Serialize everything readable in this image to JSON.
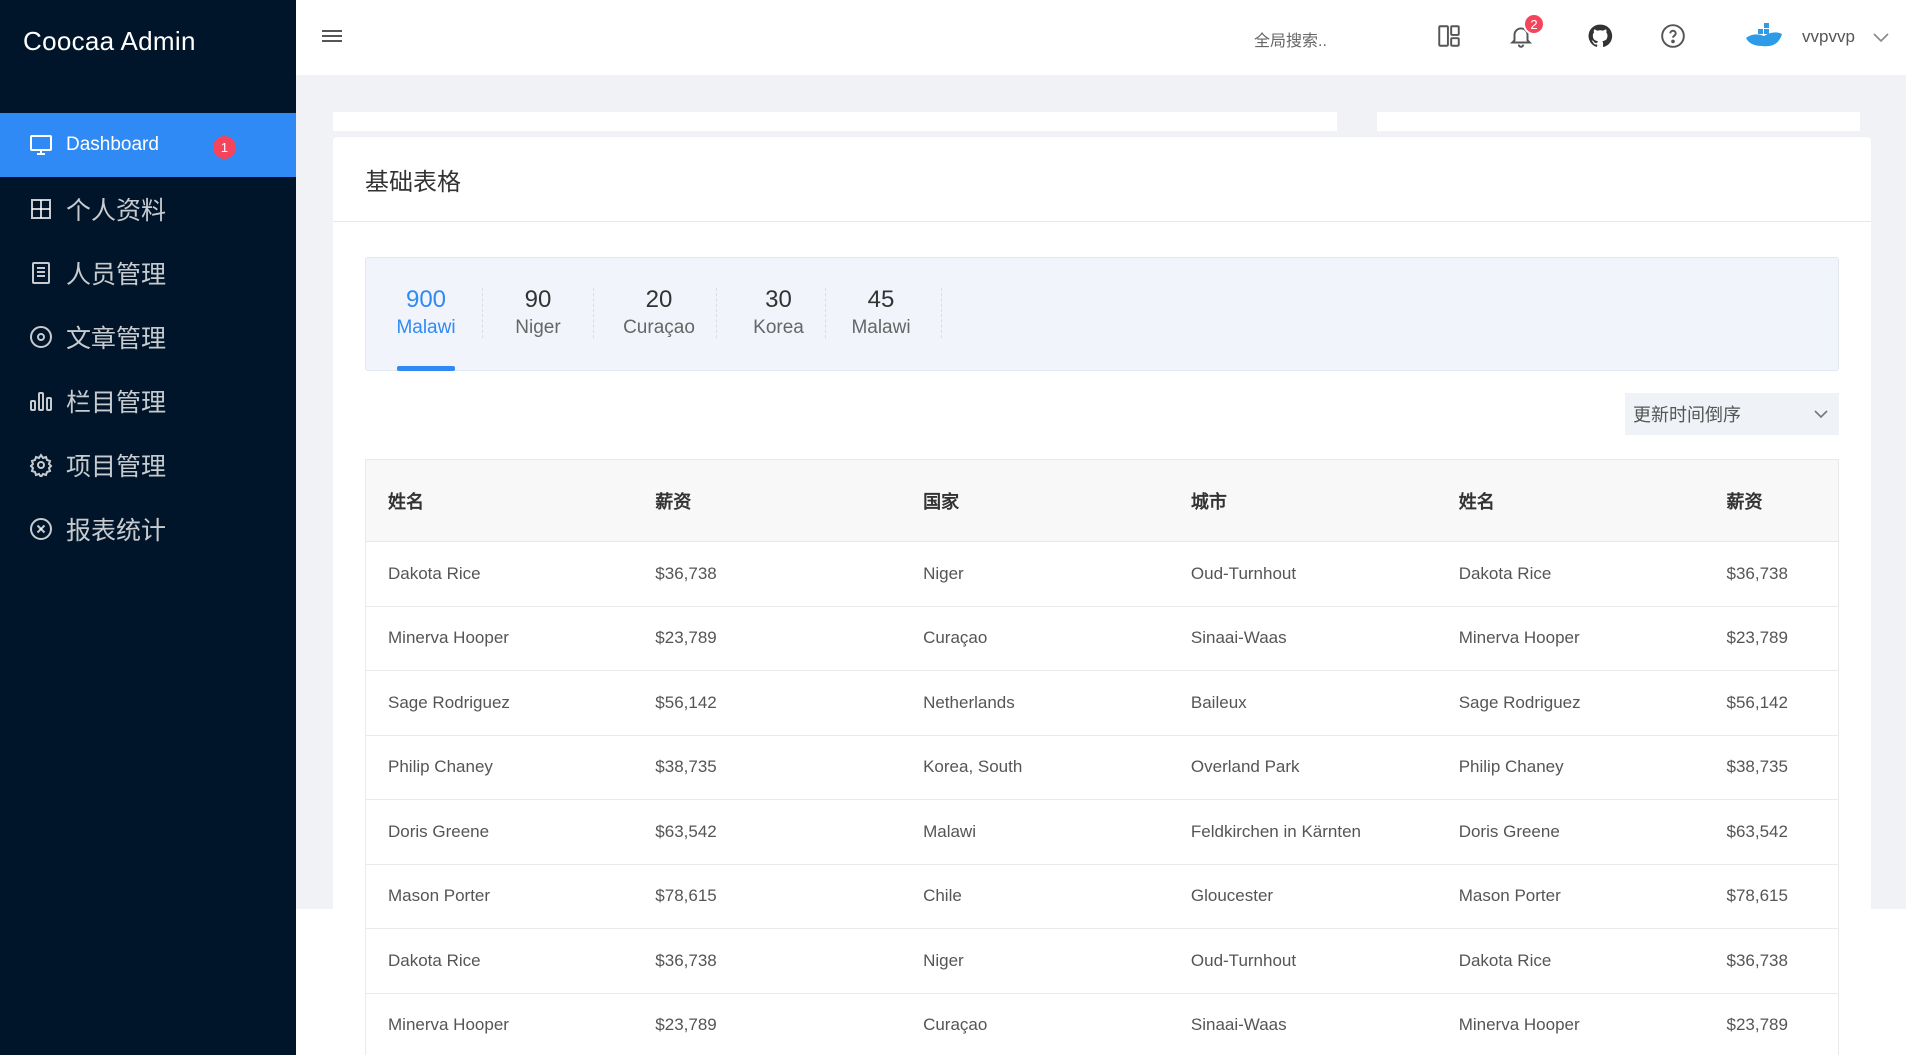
{
  "app": {
    "title": "Coocaa Admin"
  },
  "sidebar": {
    "items": [
      {
        "label": "Dashboard",
        "icon": "monitor-icon",
        "badge": "1",
        "active": true
      },
      {
        "label": "个人资料",
        "icon": "grid-icon"
      },
      {
        "label": "人员管理",
        "icon": "document-icon"
      },
      {
        "label": "文章管理",
        "icon": "target-icon"
      },
      {
        "label": "栏目管理",
        "icon": "bar-chart-icon"
      },
      {
        "label": "项目管理",
        "icon": "gear-icon"
      },
      {
        "label": "报表统计",
        "icon": "close-circle-icon"
      }
    ]
  },
  "header": {
    "search_text": "全局搜索..",
    "notification_count": "2",
    "username": "vvpvvp"
  },
  "card": {
    "title": "基础表格",
    "stats": [
      {
        "value": "900",
        "label": "Malawi",
        "active": true
      },
      {
        "value": "90",
        "label": "Niger"
      },
      {
        "value": "20",
        "label": "Curaçao"
      },
      {
        "value": "30",
        "label": "Korea"
      },
      {
        "value": "45",
        "label": "Malawi"
      }
    ],
    "sort_select": "更新时间倒序"
  },
  "table": {
    "headers": [
      "姓名",
      "薪资",
      "国家",
      "城市",
      "姓名",
      "薪资"
    ],
    "rows": [
      [
        "Dakota Rice",
        "$36,738",
        "Niger",
        "Oud-Turnhout",
        "Dakota Rice",
        "$36,738"
      ],
      [
        "Minerva Hooper",
        "$23,789",
        "Curaçao",
        "Sinaai-Waas",
        "Minerva Hooper",
        "$23,789"
      ],
      [
        "Sage Rodriguez",
        "$56,142",
        "Netherlands",
        "Baileux",
        "Sage Rodriguez",
        "$56,142"
      ],
      [
        "Philip Chaney",
        "$38,735",
        "Korea, South",
        "Overland Park",
        "Philip Chaney",
        "$38,735"
      ],
      [
        "Doris Greene",
        "$63,542",
        "Malawi",
        "Feldkirchen in Kärnten",
        "Doris Greene",
        "$63,542"
      ],
      [
        "Mason Porter",
        "$78,615",
        "Chile",
        "Gloucester",
        "Mason Porter",
        "$78,615"
      ],
      [
        "Dakota Rice",
        "$36,738",
        "Niger",
        "Oud-Turnhout",
        "Dakota Rice",
        "$36,738"
      ],
      [
        "Minerva Hooper",
        "$23,789",
        "Curaçao",
        "Sinaai-Waas",
        "Minerva Hooper",
        "$23,789"
      ]
    ]
  },
  "colors": {
    "sidebar_bg": "#001529",
    "accent": "#2f8af5",
    "badge": "#f5455c"
  }
}
